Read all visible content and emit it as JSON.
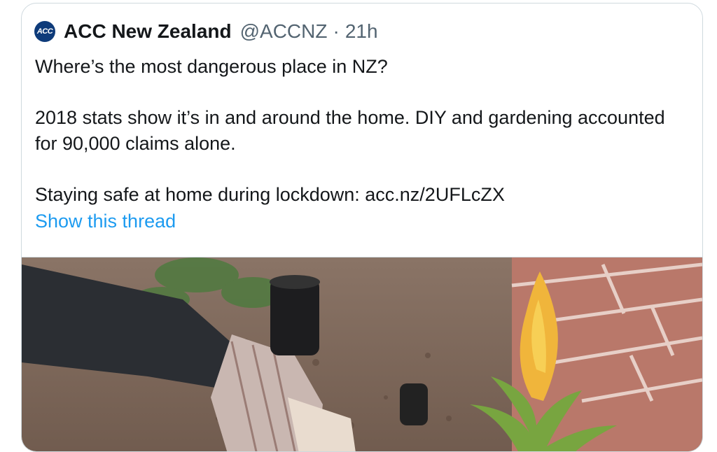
{
  "tweet": {
    "avatar_text": "ACC",
    "display_name": "ACC New Zealand",
    "handle": "@ACCNZ",
    "separator": "·",
    "time": "21h",
    "lines": [
      "Where’s the most dangerous place in NZ?",
      "2018 stats show it’s in and around the home. DIY and gardening accounted for 90,000 claims alone.",
      "Staying safe at home during lockdown:  acc.nz/2UFLcZX"
    ],
    "show_thread": "Show this thread"
  },
  "colors": {
    "link": "#1d9bf0",
    "secondary": "#536471",
    "border": "#cfd9de",
    "brand": "#0e3b7a"
  },
  "media": {
    "icon": "photo-gardening-image"
  }
}
